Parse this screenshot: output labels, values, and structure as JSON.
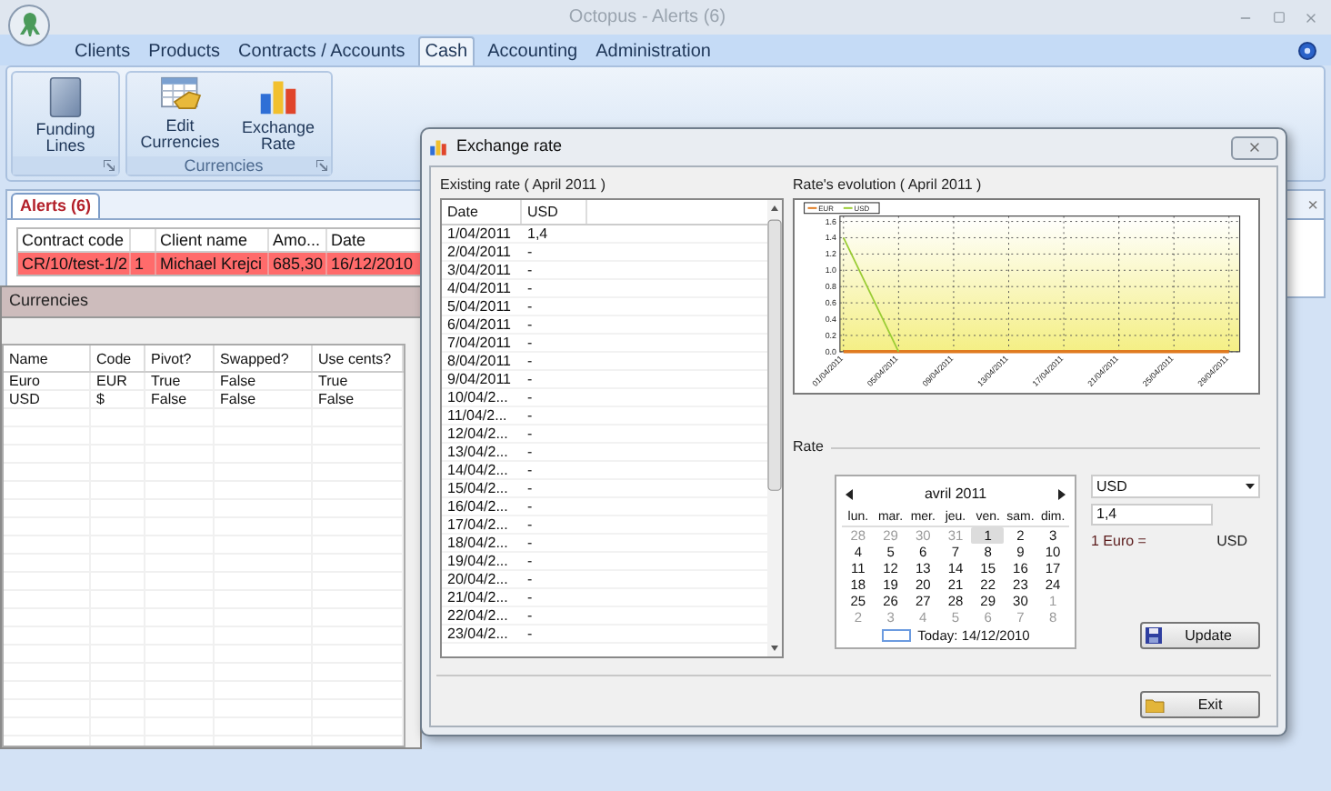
{
  "window": {
    "title": "Octopus - Alerts (6)"
  },
  "menu_tabs": [
    {
      "label": "Clients",
      "selected": false
    },
    {
      "label": "Products",
      "selected": false
    },
    {
      "label": "Contracts / Accounts",
      "selected": false
    },
    {
      "label": "Cash",
      "selected": true
    },
    {
      "label": "Accounting",
      "selected": false
    },
    {
      "label": "Administration",
      "selected": false
    }
  ],
  "ribbon_groups": [
    {
      "buttons": [
        {
          "label": "Funding Lines",
          "kind": "panel"
        }
      ]
    },
    {
      "caption": "Currencies",
      "buttons": [
        {
          "label": "Edit Currencies",
          "kind": "table"
        },
        {
          "label": "Exchange Rate",
          "kind": "chart"
        }
      ]
    }
  ],
  "alerts": {
    "tab": {
      "label": "Alerts (6)",
      "selected": true
    },
    "close": "×",
    "columns": [
      {
        "label": "Contract code"
      },
      {},
      {
        "label": "Client name"
      },
      {
        "label": "Amo..."
      },
      {
        "label": "Date"
      }
    ],
    "rows": [
      {
        "cells": [
          "CR/10/test-1/2",
          "1",
          "Michael Krejci",
          "685,30",
          "16/12/2010"
        ]
      }
    ]
  },
  "currencies_window": {
    "title": "Currencies",
    "columns": [
      "Name",
      "Code",
      "Pivot?",
      "Swapped?",
      "Use cents?"
    ],
    "rows": [
      [
        "Euro",
        "EUR",
        "True",
        "False",
        "True"
      ],
      [
        "USD",
        "$",
        "False",
        "False",
        "False"
      ]
    ]
  },
  "exchange_dialog": {
    "title": "Exchange rate",
    "existing_rate": {
      "caption": "Existing rate ( April 2011 )",
      "columns": [
        "Date",
        "USD"
      ],
      "rows": [
        {
          "date": "1/04/2011",
          "usd": "1,4"
        },
        {
          "date": "2/04/2011",
          "usd": "-"
        },
        {
          "date": "3/04/2011",
          "usd": "-"
        },
        {
          "date": "4/04/2011",
          "usd": "-"
        },
        {
          "date": "5/04/2011",
          "usd": "-"
        },
        {
          "date": "6/04/2011",
          "usd": "-"
        },
        {
          "date": "7/04/2011",
          "usd": "-"
        },
        {
          "date": "8/04/2011",
          "usd": "-"
        },
        {
          "date": "9/04/2011",
          "usd": "-"
        },
        {
          "date": "10/04/2...",
          "usd": "-"
        },
        {
          "date": "11/04/2...",
          "usd": "-"
        },
        {
          "date": "12/04/2...",
          "usd": "-"
        },
        {
          "date": "13/04/2...",
          "usd": "-"
        },
        {
          "date": "14/04/2...",
          "usd": "-"
        },
        {
          "date": "15/04/2...",
          "usd": "-"
        },
        {
          "date": "16/04/2...",
          "usd": "-"
        },
        {
          "date": "17/04/2...",
          "usd": "-"
        },
        {
          "date": "18/04/2...",
          "usd": "-"
        },
        {
          "date": "19/04/2...",
          "usd": "-"
        },
        {
          "date": "20/04/2...",
          "usd": "-"
        },
        {
          "date": "21/04/2...",
          "usd": "-"
        },
        {
          "date": "22/04/2...",
          "usd": "-"
        },
        {
          "date": "23/04/2...",
          "usd": "-"
        }
      ]
    },
    "evolution": {
      "caption": "Rate's evolution ( April 2011 )",
      "chart_data": {
        "type": "line",
        "categories": [
          "01/04/2011",
          "05/04/2011",
          "09/04/2011",
          "13/04/2011",
          "17/04/2011",
          "21/04/2011",
          "25/04/2011",
          "29/04/2011"
        ],
        "ylim": [
          0,
          1.6
        ],
        "yticks": [
          {
            "value": 0,
            "label": "0.0"
          },
          {
            "value": 0.2,
            "label": "0.2"
          },
          {
            "value": 0.4,
            "label": "0.4"
          },
          {
            "value": 0.6,
            "label": "0.6"
          },
          {
            "value": 0.8,
            "label": "0.8"
          },
          {
            "value": 1,
            "label": "1.0"
          },
          {
            "value": 1.2,
            "label": "1.2"
          },
          {
            "value": 1.4,
            "label": "1.4"
          },
          {
            "value": 1.6,
            "label": "1.6"
          }
        ],
        "series": [
          {
            "name": "EUR",
            "color": "#e07b20",
            "values": [
              0,
              0,
              0,
              0,
              0,
              0,
              0,
              0
            ]
          },
          {
            "name": "USD",
            "color": "#99cc33",
            "values": [
              1.4,
              0,
              null,
              null,
              null,
              null,
              null,
              null
            ]
          }
        ],
        "grid": true,
        "legend": "upper left"
      }
    },
    "rate": {
      "caption": "Rate",
      "calendar": {
        "month": "avril 2011",
        "weekdays": [
          "lun.",
          "mar.",
          "mer.",
          "jeu.",
          "ven.",
          "sam.",
          "dim."
        ],
        "weeks": [
          [
            {
              "day": "28",
              "other": true,
              "selected": false
            },
            {
              "day": "29",
              "other": true,
              "selected": false
            },
            {
              "day": "30",
              "other": true,
              "selected": false
            },
            {
              "day": "31",
              "other": true,
              "selected": false
            },
            {
              "day": "1",
              "other": false,
              "selected": true
            },
            {
              "day": "2",
              "other": false,
              "selected": false
            },
            {
              "day": "3",
              "other": false,
              "selected": false
            }
          ],
          [
            {
              "day": "4",
              "other": false,
              "selected": false
            },
            {
              "day": "5",
              "other": false,
              "selected": false
            },
            {
              "day": "6",
              "other": false,
              "selected": false
            },
            {
              "day": "7",
              "other": false,
              "selected": false
            },
            {
              "day": "8",
              "other": false,
              "selected": false
            },
            {
              "day": "9",
              "other": false,
              "selected": false
            },
            {
              "day": "10",
              "other": false,
              "selected": false
            }
          ],
          [
            {
              "day": "11",
              "other": false,
              "selected": false
            },
            {
              "day": "12",
              "other": false,
              "selected": false
            },
            {
              "day": "13",
              "other": false,
              "selected": false
            },
            {
              "day": "14",
              "other": false,
              "selected": false
            },
            {
              "day": "15",
              "other": false,
              "selected": false
            },
            {
              "day": "16",
              "other": false,
              "selected": false
            },
            {
              "day": "17",
              "other": false,
              "selected": false
            }
          ],
          [
            {
              "day": "18",
              "other": false,
              "selected": false
            },
            {
              "day": "19",
              "other": false,
              "selected": false
            },
            {
              "day": "20",
              "other": false,
              "selected": false
            },
            {
              "day": "21",
              "other": false,
              "selected": false
            },
            {
              "day": "22",
              "other": false,
              "selected": false
            },
            {
              "day": "23",
              "other": false,
              "selected": false
            },
            {
              "day": "24",
              "other": false,
              "selected": false
            }
          ],
          [
            {
              "day": "25",
              "other": false,
              "selected": false
            },
            {
              "day": "26",
              "other": false,
              "selected": false
            },
            {
              "day": "27",
              "other": false,
              "selected": false
            },
            {
              "day": "28",
              "other": false,
              "selected": false
            },
            {
              "day": "29",
              "other": false,
              "selected": false
            },
            {
              "day": "30",
              "other": false,
              "selected": false
            },
            {
              "day": "1",
              "other": true,
              "selected": false
            }
          ],
          [
            {
              "day": "2",
              "other": true,
              "selected": false
            },
            {
              "day": "3",
              "other": true,
              "selected": false
            },
            {
              "day": "4",
              "other": true,
              "selected": false
            },
            {
              "day": "5",
              "other": true,
              "selected": false
            },
            {
              "day": "6",
              "other": true,
              "selected": false
            },
            {
              "day": "7",
              "other": true,
              "selected": false
            },
            {
              "day": "8",
              "other": true,
              "selected": false
            }
          ]
        ],
        "today": "Today: 14/12/2010"
      },
      "currency": "USD",
      "value": "1,4",
      "from_label": "1 Euro =",
      "to_label": "USD",
      "update_button": "Update"
    },
    "exit_button": "Exit"
  }
}
